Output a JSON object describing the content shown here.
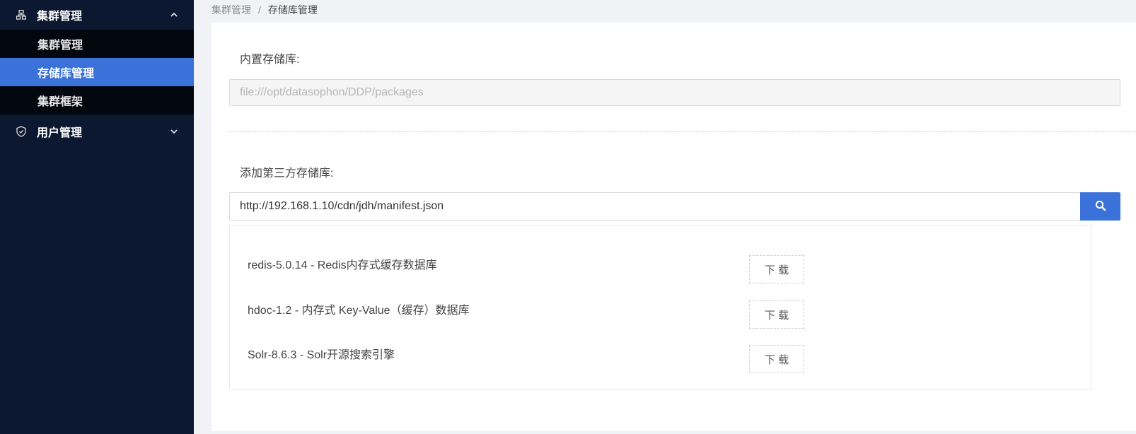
{
  "sidebar": {
    "groups": [
      {
        "label": "集群管理",
        "icon": "cluster-icon",
        "expanded": true,
        "items": [
          {
            "label": "集群管理",
            "active": false
          },
          {
            "label": "存储库管理",
            "active": true
          },
          {
            "label": "集群框架",
            "active": false
          }
        ]
      },
      {
        "label": "用户管理",
        "icon": "shield-icon",
        "expanded": false
      }
    ]
  },
  "breadcrumb": {
    "parent": "集群管理",
    "separator": "/",
    "current": "存储库管理"
  },
  "builtin": {
    "label": "内置存储库:",
    "value": "file:///opt/datasophon/DDP/packages"
  },
  "third_party": {
    "label": "添加第三方存储库:",
    "url_value": "http://192.168.1.10/cdn/jdh/manifest.json",
    "search_icon": "search-icon"
  },
  "results": [
    {
      "name": "redis-5.0.14 - Redis内存式缓存数据库",
      "button": "下 载"
    },
    {
      "name": "hdoc-1.2 - 内存式 Key-Value（缓存）数据库",
      "button": "下 载"
    },
    {
      "name": "Solr-8.6.3 - Solr开源搜索引擎",
      "button": "下 载"
    }
  ],
  "colors": {
    "sidebar_bg": "#0c1730",
    "submenu_bg": "#02070f",
    "accent": "#3a72d9"
  }
}
